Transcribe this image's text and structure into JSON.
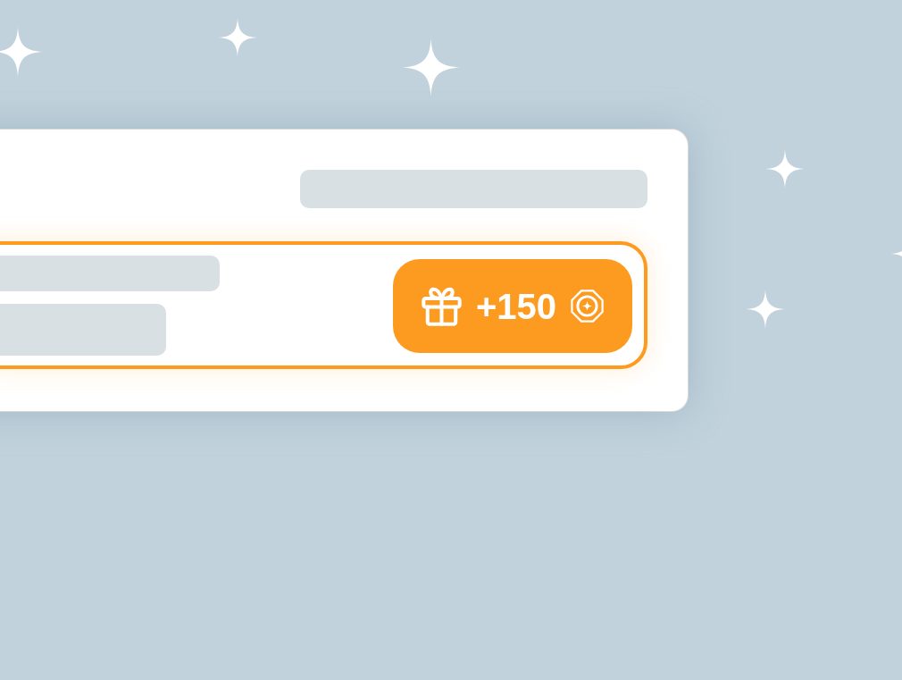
{
  "card": {
    "task_row": {
      "highlighted": true,
      "reward": "+150"
    }
  }
}
